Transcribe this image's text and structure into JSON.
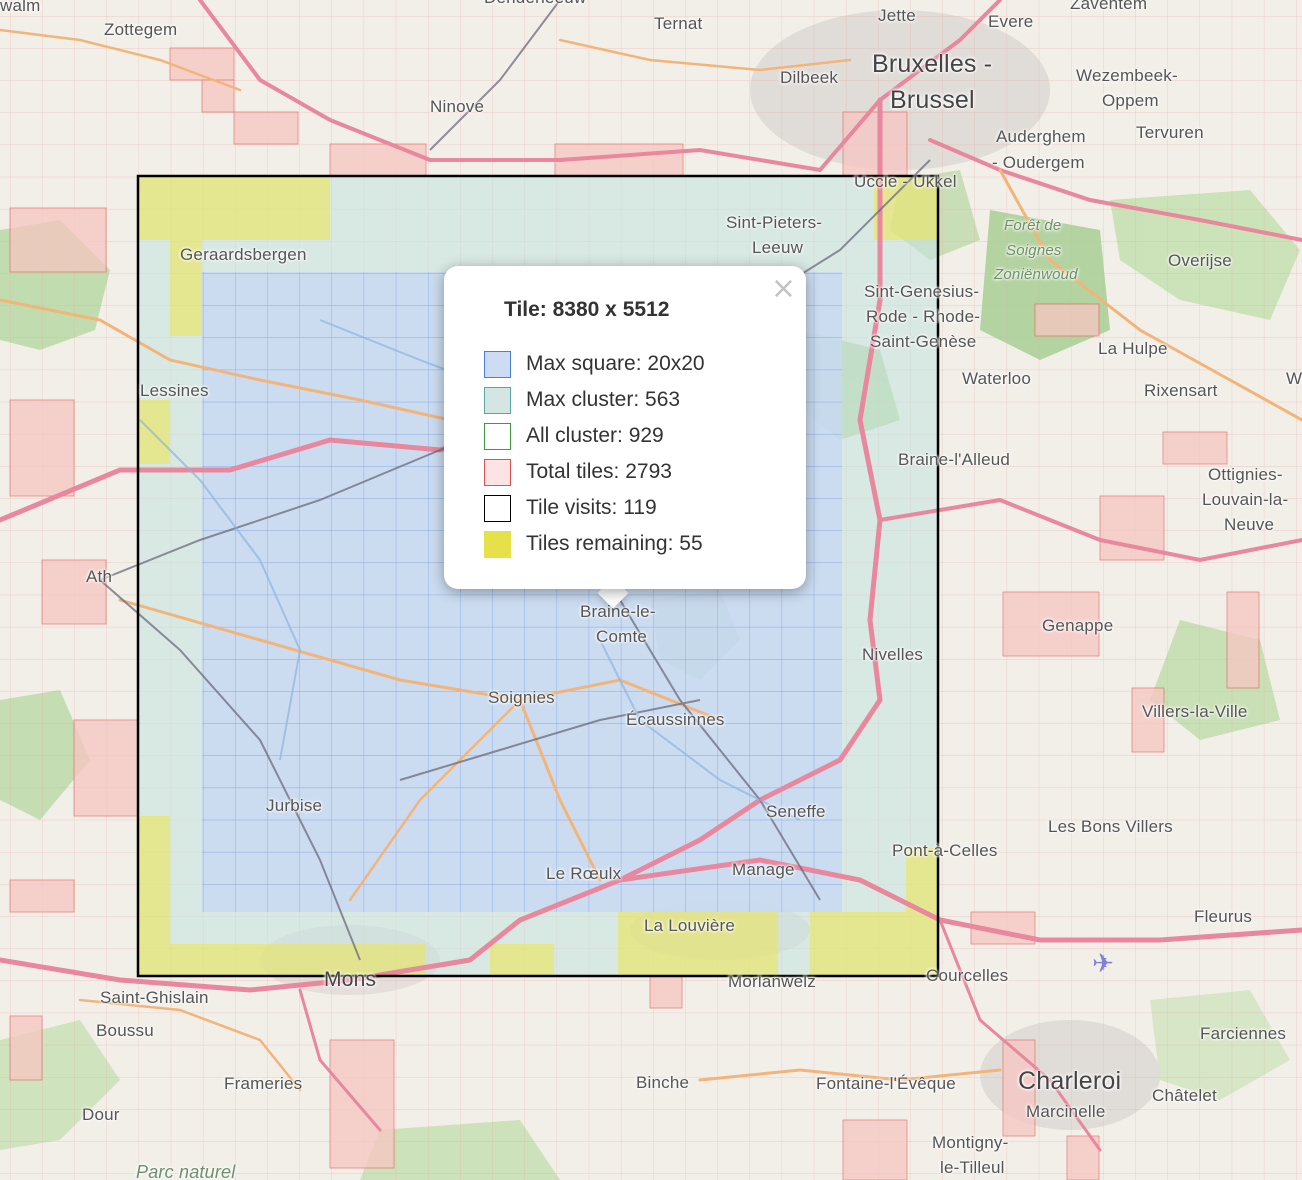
{
  "popup": {
    "title": "Tile: 8380 x 5512",
    "close_icon": "×",
    "legend": [
      {
        "label": "Max square: 20x20",
        "fill": "#cddcf2",
        "border": "#4a7fe0"
      },
      {
        "label": "Max cluster: 563",
        "fill": "#d3e6e3",
        "border": "#5aa89f"
      },
      {
        "label": "All cluster: 929",
        "fill": "#ffffff",
        "border": "#3e9a3e"
      },
      {
        "label": "Total tiles: 2793",
        "fill": "#fde3e3",
        "border": "#e05050"
      },
      {
        "label": "Tile visits: 119",
        "fill": "#ffffff",
        "border": "#000000"
      },
      {
        "label": "Tiles remaining: 55",
        "fill": "#e6e04a",
        "border": "#e6e04a"
      }
    ]
  },
  "places": [
    {
      "id": "walm",
      "label": "walm"
    },
    {
      "id": "zottegem",
      "label": "Zottegem"
    },
    {
      "id": "denderleeuw",
      "label": "Denderleeuw"
    },
    {
      "id": "ternat",
      "label": "Ternat"
    },
    {
      "id": "jette",
      "label": "Jette"
    },
    {
      "id": "evere",
      "label": "Evere"
    },
    {
      "id": "zaventem",
      "label": "Zaventem"
    },
    {
      "id": "dilbeek",
      "label": "Dilbeek"
    },
    {
      "id": "bruxelles",
      "label": "Bruxelles -"
    },
    {
      "id": "brussel",
      "label": "Brussel"
    },
    {
      "id": "wezembeek",
      "label": "Wezembeek-"
    },
    {
      "id": "oppem",
      "label": "Oppem"
    },
    {
      "id": "ninove",
      "label": "Ninove"
    },
    {
      "id": "auderghem",
      "label": "Auderghem"
    },
    {
      "id": "oudergem",
      "label": "- Oudergem"
    },
    {
      "id": "tervuren",
      "label": "Tervuren"
    },
    {
      "id": "uccle",
      "label": "Uccle - Ukkel"
    },
    {
      "id": "sint-pieters",
      "label": "Sint-Pieters-"
    },
    {
      "id": "leeuw",
      "label": "Leeuw"
    },
    {
      "id": "foret",
      "label": "Forêt de"
    },
    {
      "id": "soignes",
      "label": "Soignes"
    },
    {
      "id": "zonienwoud",
      "label": "Zoniënwoud"
    },
    {
      "id": "overijse",
      "label": "Overijse"
    },
    {
      "id": "geraardsbergen",
      "label": "Geraardsbergen"
    },
    {
      "id": "sint-genesius",
      "label": "Sint-Genesius-"
    },
    {
      "id": "rode",
      "label": "Rode - Rhode-"
    },
    {
      "id": "saint-genese",
      "label": "Saint-Genèse"
    },
    {
      "id": "la-hulpe",
      "label": "La Hulpe"
    },
    {
      "id": "waterloo",
      "label": "Waterloo"
    },
    {
      "id": "rixensart",
      "label": "Rixensart"
    },
    {
      "id": "w",
      "label": "W"
    },
    {
      "id": "lessines",
      "label": "Lessines"
    },
    {
      "id": "braine-lalleud",
      "label": "Braine-l'Alleud"
    },
    {
      "id": "ottignies",
      "label": "Ottignies-"
    },
    {
      "id": "louvain",
      "label": "Louvain-la-"
    },
    {
      "id": "neuve",
      "label": "Neuve"
    },
    {
      "id": "ath",
      "label": "Ath"
    },
    {
      "id": "braine-le",
      "label": "Braine-le-"
    },
    {
      "id": "comte",
      "label": "Comte"
    },
    {
      "id": "genappe",
      "label": "Genappe"
    },
    {
      "id": "nivelles",
      "label": "Nivelles"
    },
    {
      "id": "soignies",
      "label": "Soignies"
    },
    {
      "id": "ecaussinnes",
      "label": "Écaussinnes"
    },
    {
      "id": "villers",
      "label": "Villers-la-Ville"
    },
    {
      "id": "jurbise",
      "label": "Jurbise"
    },
    {
      "id": "seneffe",
      "label": "Seneffe"
    },
    {
      "id": "les-bons-villers",
      "label": "Les Bons Villers"
    },
    {
      "id": "pont-a-celles",
      "label": "Pont-à-Celles"
    },
    {
      "id": "le-roeulx",
      "label": "Le Rœulx"
    },
    {
      "id": "manage",
      "label": "Manage"
    },
    {
      "id": "fleurus",
      "label": "Fleurus"
    },
    {
      "id": "la-louviere",
      "label": "La Louvière"
    },
    {
      "id": "mons",
      "label": "Mons"
    },
    {
      "id": "morlanwelz",
      "label": "Morlanwelz"
    },
    {
      "id": "courcelles",
      "label": "Courcelles"
    },
    {
      "id": "saint-ghislain",
      "label": "Saint-Ghislain"
    },
    {
      "id": "boussu",
      "label": "Boussu"
    },
    {
      "id": "farciennes",
      "label": "Farciennes"
    },
    {
      "id": "frameries",
      "label": "Frameries"
    },
    {
      "id": "binche",
      "label": "Binche"
    },
    {
      "id": "fontaine",
      "label": "Fontaine-l'Évêque"
    },
    {
      "id": "charleroi",
      "label": "Charleroi"
    },
    {
      "id": "marcinelle",
      "label": "Marcinelle"
    },
    {
      "id": "chatelet",
      "label": "Châtelet"
    },
    {
      "id": "dour",
      "label": "Dour"
    },
    {
      "id": "montigny",
      "label": "Montigny-"
    },
    {
      "id": "le-tilleul",
      "label": "le-Tilleul"
    },
    {
      "id": "parc",
      "label": "Parc naturel"
    }
  ]
}
